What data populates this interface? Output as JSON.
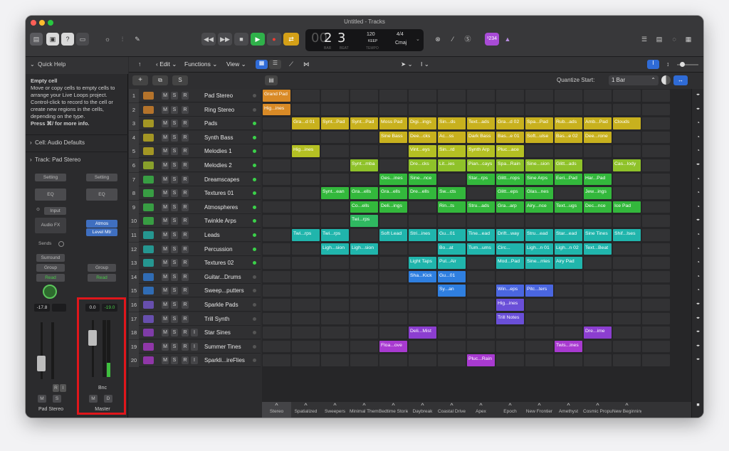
{
  "window": {
    "title": "Untitled - Tracks"
  },
  "transport": {
    "bar": "2",
    "beat": "3",
    "bar_lbl": "BAR",
    "beat_lbl": "BEAT",
    "tempo": "120",
    "tempo_sub": "KEEP",
    "tempo_lbl": "TEMPO",
    "sig": "4/4",
    "key": "Cmaj",
    "count": "¹234"
  },
  "quick_help": {
    "header": "Quick Help",
    "title": "Empty cell",
    "body": [
      "Move or copy cells to empty cells to",
      "arrange your Live Loops project.",
      "Control-click to record to the cell or",
      "create new regions in the cells,",
      "depending on the type."
    ],
    "hint": "Press ⌘/ for more info.",
    "cell_row": "Cell: Audio Defaults",
    "track_row": "Track:  Pad Stereo"
  },
  "strip_left": {
    "setting": "Setting",
    "eq": "EQ",
    "input": "Input",
    "audio_fx": "Audio FX",
    "sends": "Sends",
    "surround": "Surround",
    "group": "Group",
    "read": "Read",
    "vol": "-17.8",
    "r": "R",
    "i": "I",
    "m": "M",
    "s": "S",
    "name": "Pad Stereo"
  },
  "strip_right": {
    "setting": "Setting",
    "eq": "EQ",
    "atmos": "Atmos",
    "level_mtr": "Level Mtr",
    "group": "Group",
    "read": "Read",
    "vol": "0.0",
    "peak": "-19.0",
    "bnc": "Bnc",
    "m": "M",
    "d": "D",
    "name": "Master"
  },
  "toolbar": {
    "edit": "Edit",
    "functions": "Functions",
    "view": "View",
    "quantize_label": "Quantize Start:",
    "quantize_value": "1 Bar"
  },
  "track_buttons": {
    "m": "M",
    "s": "S",
    "r": "R",
    "i": "I"
  },
  "tracks": [
    {
      "num": "1",
      "name": "Pad Stereo",
      "color": "#e08a2a"
    },
    {
      "num": "2",
      "name": "Ring Stereo",
      "color": "#e08a2a"
    },
    {
      "num": "3",
      "name": "Pads",
      "color": "#c9b820"
    },
    {
      "num": "4",
      "name": "Synth Bass",
      "color": "#c9b820"
    },
    {
      "num": "5",
      "name": "Melodies 1",
      "color": "#c9b820"
    },
    {
      "num": "6",
      "name": "Melodies 2",
      "color": "#a6c62a"
    },
    {
      "num": "7",
      "name": "Dreamscapes",
      "color": "#3bc24a"
    },
    {
      "num": "8",
      "name": "Textures 01",
      "color": "#3bc24a"
    },
    {
      "num": "9",
      "name": "Atmospheres",
      "color": "#3bc24a"
    },
    {
      "num": "10",
      "name": "Twinkle Arps",
      "color": "#3bc24a"
    },
    {
      "num": "11",
      "name": "Leads",
      "color": "#22b8b0"
    },
    {
      "num": "12",
      "name": "Percussion",
      "color": "#22b8b0"
    },
    {
      "num": "13",
      "name": "Textures 02",
      "color": "#22b8b0"
    },
    {
      "num": "14",
      "name": "Guitar...Drums",
      "color": "#3080e0"
    },
    {
      "num": "15",
      "name": "Sweep...putters",
      "color": "#3080e0"
    },
    {
      "num": "16",
      "name": "Sparkle Pads",
      "color": "#7a5ad8"
    },
    {
      "num": "17",
      "name": "Trill Synth",
      "color": "#7a5ad8"
    },
    {
      "num": "18",
      "name": "Star Sines",
      "color": "#9a40d0"
    },
    {
      "num": "19",
      "name": "Summer Tines",
      "color": "#b03ad0"
    },
    {
      "num": "20",
      "name": "Sparkli...ireFlies",
      "color": "#b03ad0"
    }
  ],
  "cells": [
    {
      "r": 0,
      "c": 0,
      "t": "Grand Pad",
      "color": "#d98a26"
    },
    {
      "r": 1,
      "c": 0,
      "t": "Hig...ines",
      "color": "#d98a26"
    },
    {
      "r": 2,
      "c": 1,
      "t": "Gra...d 01",
      "color": "#c8b11e"
    },
    {
      "r": 2,
      "c": 2,
      "t": "Synt...Pad",
      "color": "#c8b11e"
    },
    {
      "r": 2,
      "c": 3,
      "t": "Synt...Pad",
      "color": "#c8b11e"
    },
    {
      "r": 2,
      "c": 4,
      "t": "Moss Pad",
      "color": "#c8b11e"
    },
    {
      "r": 2,
      "c": 5,
      "t": "Digi...ings",
      "color": "#c8b11e"
    },
    {
      "r": 2,
      "c": 6,
      "t": "Sin...ds",
      "color": "#c8b11e"
    },
    {
      "r": 2,
      "c": 7,
      "t": "Text...ads",
      "color": "#c8b11e"
    },
    {
      "r": 2,
      "c": 8,
      "t": "Gra...d 02",
      "color": "#c8b11e"
    },
    {
      "r": 2,
      "c": 9,
      "t": "Spa...Pad",
      "color": "#c8b11e"
    },
    {
      "r": 2,
      "c": 10,
      "t": "Rub...ads",
      "color": "#c8b11e"
    },
    {
      "r": 2,
      "c": 11,
      "t": "Amb...Pad",
      "color": "#c8b11e"
    },
    {
      "r": 2,
      "c": 12,
      "t": "Clouds",
      "color": "#c8b11e"
    },
    {
      "r": 3,
      "c": 4,
      "t": "Sine Bass",
      "color": "#c8b11e"
    },
    {
      "r": 3,
      "c": 5,
      "t": "Dee...cks",
      "color": "#c8b11e"
    },
    {
      "r": 3,
      "c": 6,
      "t": "Ac...ss",
      "color": "#c8b11e"
    },
    {
      "r": 3,
      "c": 7,
      "t": "Dark Bass",
      "color": "#c8b11e"
    },
    {
      "r": 3,
      "c": 8,
      "t": "Bas...e 01",
      "color": "#c8b11e"
    },
    {
      "r": 3,
      "c": 9,
      "t": "Soft...ulse",
      "color": "#c8b11e"
    },
    {
      "r": 3,
      "c": 10,
      "t": "Bas...e 02",
      "color": "#c8b11e"
    },
    {
      "r": 3,
      "c": 11,
      "t": "Dee...rone",
      "color": "#c8b11e"
    },
    {
      "r": 4,
      "c": 1,
      "t": "Hig...ines",
      "color": "#b4c023"
    },
    {
      "r": 4,
      "c": 5,
      "t": "Vint...eys",
      "color": "#b4c023"
    },
    {
      "r": 4,
      "c": 6,
      "t": "Sin...rd",
      "color": "#b4c023"
    },
    {
      "r": 4,
      "c": 7,
      "t": "Synth Arp",
      "color": "#b4c023"
    },
    {
      "r": 4,
      "c": 8,
      "t": "Pluc...ace",
      "color": "#b4c023"
    },
    {
      "r": 5,
      "c": 3,
      "t": "Synt...mba",
      "color": "#8fc22a"
    },
    {
      "r": 5,
      "c": 5,
      "t": "Dre...cks",
      "color": "#8fc22a"
    },
    {
      "r": 5,
      "c": 6,
      "t": "Lit...ies",
      "color": "#8fc22a"
    },
    {
      "r": 5,
      "c": 7,
      "t": "Pian...cays",
      "color": "#8fc22a"
    },
    {
      "r": 5,
      "c": 8,
      "t": "Spa...Rain",
      "color": "#8fc22a"
    },
    {
      "r": 5,
      "c": 9,
      "t": "Sine...sion",
      "color": "#8fc22a"
    },
    {
      "r": 5,
      "c": 10,
      "t": "Glitt...ads",
      "color": "#8fc22a"
    },
    {
      "r": 5,
      "c": 12,
      "t": "Cas...lody",
      "color": "#8fc22a"
    },
    {
      "r": 6,
      "c": 4,
      "t": "Ges...ines",
      "color": "#33b83c"
    },
    {
      "r": 6,
      "c": 5,
      "t": "Sine...nce",
      "color": "#33b83c"
    },
    {
      "r": 6,
      "c": 7,
      "t": "Star...rps",
      "color": "#33b83c"
    },
    {
      "r": 6,
      "c": 8,
      "t": "Glitt...rops",
      "color": "#33b83c"
    },
    {
      "r": 6,
      "c": 9,
      "t": "Sine Arps",
      "color": "#33b83c"
    },
    {
      "r": 6,
      "c": 10,
      "t": "Eeri...Pad",
      "color": "#33b83c"
    },
    {
      "r": 6,
      "c": 11,
      "t": "Har...Pad",
      "color": "#33b83c"
    },
    {
      "r": 7,
      "c": 2,
      "t": "Synt...ean",
      "color": "#33b83c"
    },
    {
      "r": 7,
      "c": 3,
      "t": "Gra...ells",
      "color": "#33b83c"
    },
    {
      "r": 7,
      "c": 4,
      "t": "Gra...ells",
      "color": "#33b83c"
    },
    {
      "r": 7,
      "c": 5,
      "t": "Dre...ells",
      "color": "#33b83c"
    },
    {
      "r": 7,
      "c": 6,
      "t": "Sw...cts",
      "color": "#33b83c"
    },
    {
      "r": 7,
      "c": 8,
      "t": "Glitt...eps",
      "color": "#33b83c"
    },
    {
      "r": 7,
      "c": 9,
      "t": "Glas...nes",
      "color": "#33b83c"
    },
    {
      "r": 7,
      "c": 11,
      "t": "Jew...ings",
      "color": "#33b83c"
    },
    {
      "r": 8,
      "c": 3,
      "t": "Co...ells",
      "color": "#33b83c"
    },
    {
      "r": 8,
      "c": 4,
      "t": "Deli...ings",
      "color": "#33b83c"
    },
    {
      "r": 8,
      "c": 6,
      "t": "Rin...ts",
      "color": "#33b83c"
    },
    {
      "r": 8,
      "c": 7,
      "t": "Stru...ads",
      "color": "#33b83c"
    },
    {
      "r": 8,
      "c": 8,
      "t": "Gra...arp",
      "color": "#33b83c"
    },
    {
      "r": 8,
      "c": 9,
      "t": "Airy...nce",
      "color": "#33b83c"
    },
    {
      "r": 8,
      "c": 10,
      "t": "Text...ugs",
      "color": "#33b83c"
    },
    {
      "r": 8,
      "c": 11,
      "t": "Dec...nce",
      "color": "#33b83c"
    },
    {
      "r": 8,
      "c": 12,
      "t": "Ice Pad",
      "color": "#33b83c"
    },
    {
      "r": 9,
      "c": 3,
      "t": "Twi...rps",
      "color": "#2fb860"
    },
    {
      "r": 10,
      "c": 1,
      "t": "Twi...rps",
      "color": "#20b5ac"
    },
    {
      "r": 10,
      "c": 2,
      "t": "Twi...rps",
      "color": "#20b5ac"
    },
    {
      "r": 10,
      "c": 4,
      "t": "Soft Lead",
      "color": "#20b5ac"
    },
    {
      "r": 10,
      "c": 5,
      "t": "Stri...ines",
      "color": "#20b5ac"
    },
    {
      "r": 10,
      "c": 6,
      "t": "Gu...01",
      "color": "#20b5ac"
    },
    {
      "r": 10,
      "c": 7,
      "t": "Tine...ead",
      "color": "#20b5ac"
    },
    {
      "r": 10,
      "c": 8,
      "t": "Drift...way",
      "color": "#20b5ac"
    },
    {
      "r": 10,
      "c": 9,
      "t": "Stru...ead",
      "color": "#20b5ac"
    },
    {
      "r": 10,
      "c": 10,
      "t": "Star...ead",
      "color": "#20b5ac"
    },
    {
      "r": 10,
      "c": 11,
      "t": "Sine Tines",
      "color": "#20b5ac"
    },
    {
      "r": 10,
      "c": 12,
      "t": "Shif...lses",
      "color": "#20b5ac"
    },
    {
      "r": 11,
      "c": 2,
      "t": "Ligh...sion",
      "color": "#20b5ac"
    },
    {
      "r": 11,
      "c": 3,
      "t": "Ligh...sion",
      "color": "#20b5ac"
    },
    {
      "r": 11,
      "c": 6,
      "t": "Bo...at",
      "color": "#20b5ac"
    },
    {
      "r": 11,
      "c": 7,
      "t": "Tum...ums",
      "color": "#20b5ac"
    },
    {
      "r": 11,
      "c": 8,
      "t": "Circ...",
      "color": "#20b5ac"
    },
    {
      "r": 11,
      "c": 9,
      "t": "Ligh...n 01",
      "color": "#20b5ac"
    },
    {
      "r": 11,
      "c": 10,
      "t": "Ligh...n 02",
      "color": "#20b5ac"
    },
    {
      "r": 11,
      "c": 11,
      "t": "Text...Beat",
      "color": "#20b5ac"
    },
    {
      "r": 12,
      "c": 5,
      "t": "Light Taps",
      "color": "#20b5ac"
    },
    {
      "r": 12,
      "c": 6,
      "t": "Pul...Air",
      "color": "#20b5ac"
    },
    {
      "r": 12,
      "c": 8,
      "t": "Mod...Pad",
      "color": "#20b5ac"
    },
    {
      "r": 12,
      "c": 9,
      "t": "Sine...rries",
      "color": "#20b5ac"
    },
    {
      "r": 12,
      "c": 10,
      "t": "Airy Pad",
      "color": "#20b5ac"
    },
    {
      "r": 13,
      "c": 5,
      "t": "Sha...Kick",
      "color": "#2f7fe0"
    },
    {
      "r": 13,
      "c": 6,
      "t": "Gu...01",
      "color": "#2f7fe0"
    },
    {
      "r": 14,
      "c": 6,
      "t": "Sy...an",
      "color": "#2f7fe0"
    },
    {
      "r": 14,
      "c": 8,
      "t": "Win...eps",
      "color": "#4a66e0"
    },
    {
      "r": 14,
      "c": 9,
      "t": "Pitc...ters",
      "color": "#4a66e0"
    },
    {
      "r": 15,
      "c": 8,
      "t": "Hig...ines",
      "color": "#6a4fd8"
    },
    {
      "r": 16,
      "c": 8,
      "t": "Trill Notes",
      "color": "#6a4fd8"
    },
    {
      "r": 17,
      "c": 5,
      "t": "Deli...Mist",
      "color": "#8c3ed0"
    },
    {
      "r": 17,
      "c": 11,
      "t": "Dre...ime",
      "color": "#8c3ed0"
    },
    {
      "r": 18,
      "c": 4,
      "t": "Floa...ove",
      "color": "#a83ad0"
    },
    {
      "r": 18,
      "c": 10,
      "t": "Twis...ines",
      "color": "#a83ad0"
    },
    {
      "r": 19,
      "c": 7,
      "t": "Pluc...Rain",
      "color": "#a83ad0"
    }
  ],
  "scenes": [
    "Stereo",
    "Spatialized",
    "Sweepers",
    "Minimal Themes",
    "Bedtime Stories",
    "Daybreak",
    "Coastal Drive",
    "Apex",
    "Epoch",
    "New Frontier",
    "Amethyst",
    "Cosmic Propulsion",
    "New Beginnings"
  ]
}
